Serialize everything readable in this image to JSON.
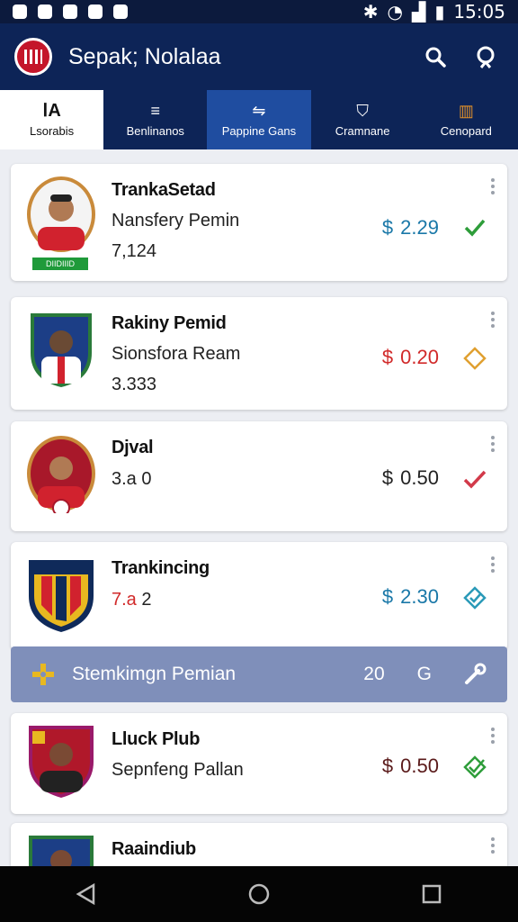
{
  "status_bar": {
    "time": "15:05"
  },
  "app": {
    "title": "Sepak; Nolalaa"
  },
  "tabs": [
    {
      "label": "Lsorabis",
      "icon": "la"
    },
    {
      "label": "Benlinanos",
      "icon": "hmm"
    },
    {
      "label": "Pappine Gans",
      "icon": "ticket"
    },
    {
      "label": "Cramnane",
      "icon": "shield"
    },
    {
      "label": "Cenopard",
      "icon": "trophy"
    }
  ],
  "cards": [
    {
      "title": "TrankaSetad",
      "subtitle": "Nansfery Pemin",
      "count": "7,124",
      "currency": "$",
      "price": "2.29",
      "price_color": "#1a78a8",
      "action_icon": "check-icon",
      "action_color": "#2e9d3a",
      "badge": "DIIDIIID"
    },
    {
      "title": "Rakiny Pemid",
      "subtitle": "Sionsfora Ream",
      "count": "3.333",
      "currency": "$",
      "price": "0.20",
      "price_color": "#d12a2a",
      "action_icon": "diamond-icon",
      "action_color": "#e0a030"
    },
    {
      "title": "Djval",
      "subtitle": "",
      "count": "3.a 0",
      "currency": "$",
      "price": "0.50",
      "price_color": "#222222",
      "action_icon": "check-icon",
      "action_color": "#d23a4a"
    },
    {
      "title": "Trankincing",
      "subtitle": "",
      "count_red": "7.a",
      "count_rest": "2",
      "currency": "$",
      "price": "2.30",
      "price_color": "#1a78a8",
      "action_icon": "diamond-check-icon",
      "action_color": "#2a9ab8"
    },
    {
      "title": "Lluck Plub",
      "subtitle": "Sepnfeng Pallan",
      "count": "",
      "currency": "$",
      "price": "0.50",
      "price_color": "#5a1a1a",
      "action_icon": "check-icon",
      "action_color": "#2e9d3a"
    },
    {
      "title": "Raaindiub",
      "subtitle": "",
      "count": ""
    }
  ],
  "banner": {
    "title": "Stemkimgn Pemian",
    "count": "20",
    "letter": "G"
  },
  "colors": {
    "navy": "#0d2457",
    "accent": "#1f4da0",
    "banner": "#7f8fba"
  }
}
